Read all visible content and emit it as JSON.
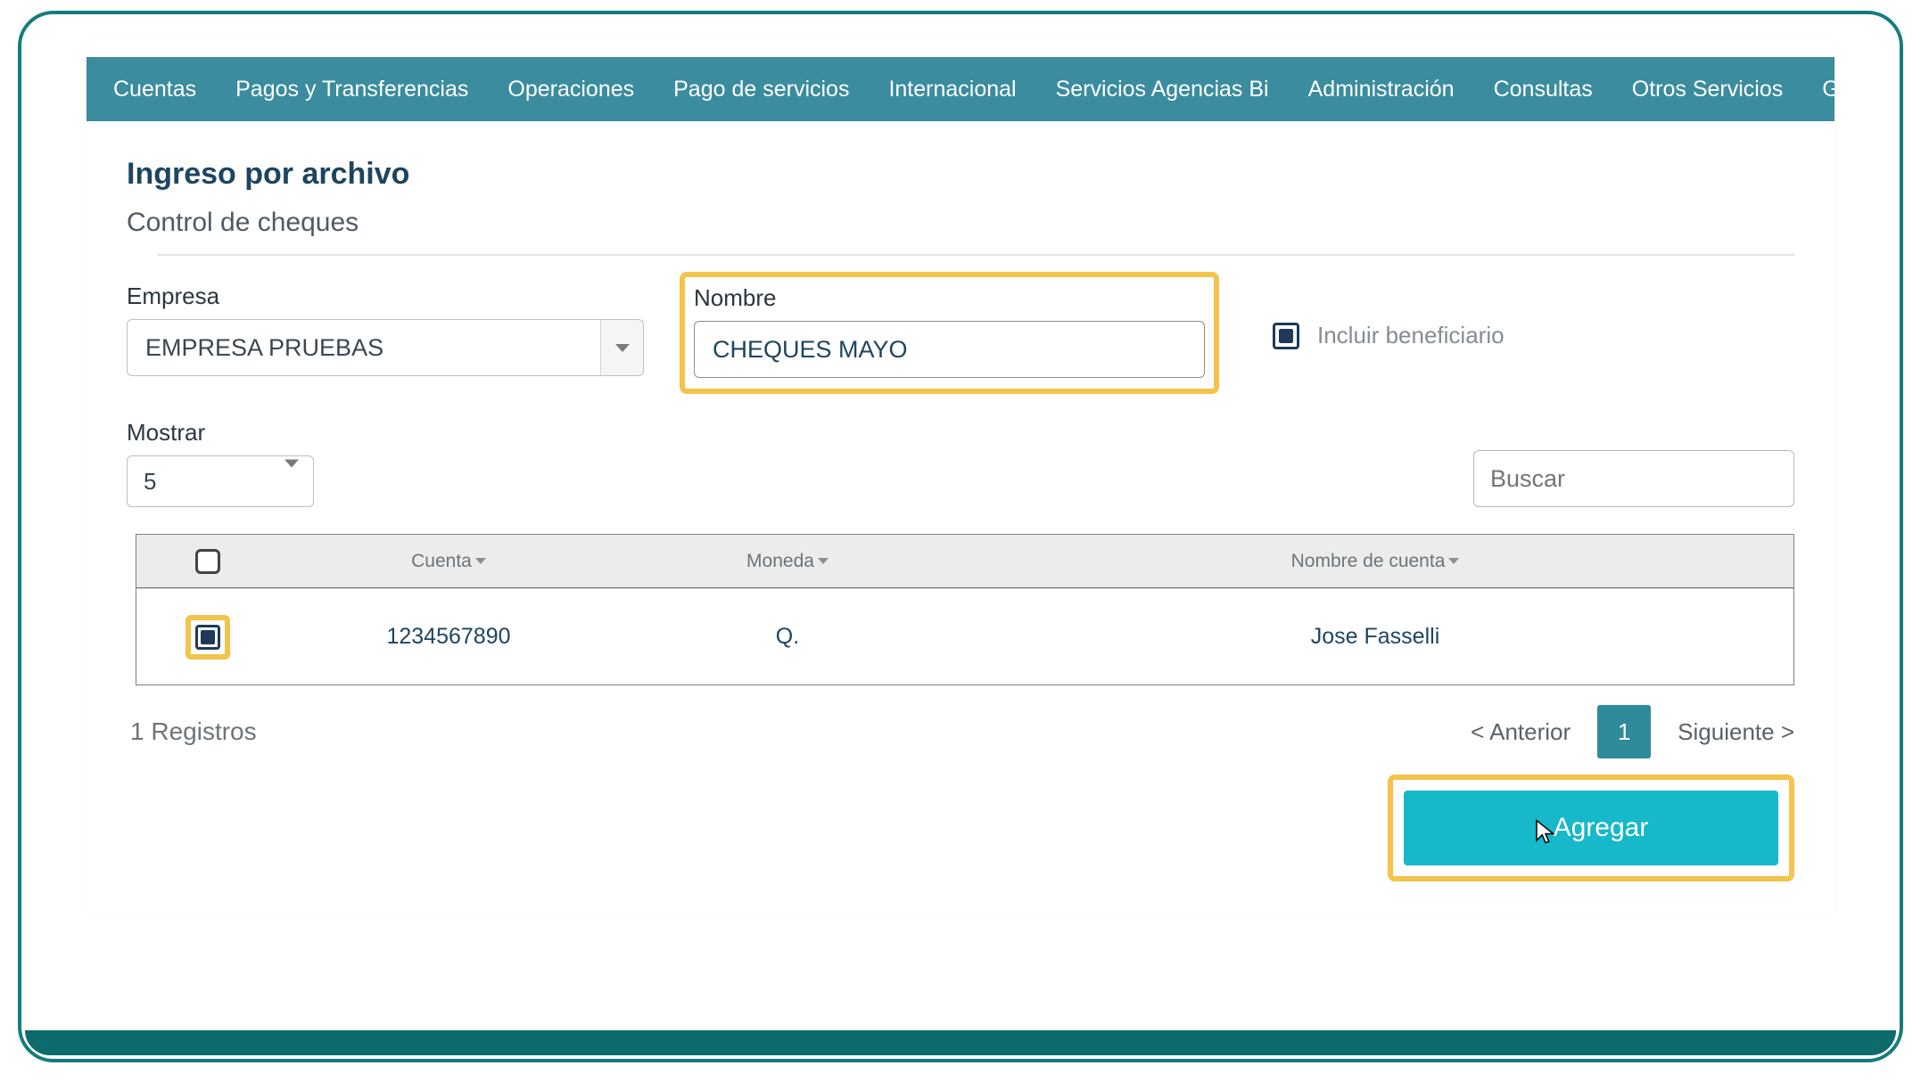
{
  "nav": {
    "items": [
      "Cuentas",
      "Pagos y Transferencias",
      "Operaciones",
      "Pago de servicios",
      "Internacional",
      "Servicios Agencias Bi",
      "Administración",
      "Consultas",
      "Otros Servicios",
      "Gestiones"
    ]
  },
  "page": {
    "title": "Ingreso por archivo",
    "subtitle": "Control de cheques"
  },
  "form": {
    "empresa_label": "Empresa",
    "empresa_value": "EMPRESA PRUEBAS",
    "nombre_label": "Nombre",
    "nombre_value": "CHEQUES MAYO",
    "incluir_label": "Incluir beneficiario",
    "incluir_checked": true,
    "mostrar_label": "Mostrar",
    "mostrar_value": "5",
    "search_placeholder": "Buscar"
  },
  "table": {
    "columns": {
      "cuenta": "Cuenta",
      "moneda": "Moneda",
      "nombre_cuenta": "Nombre de cuenta"
    },
    "rows": [
      {
        "checked": true,
        "cuenta": "1234567890",
        "moneda": "Q.",
        "nombre": "Jose Fasselli"
      }
    ]
  },
  "pagination": {
    "records_text": "1 Registros",
    "prev": "< Anterior",
    "page": "1",
    "next": "Siguiente >"
  },
  "actions": {
    "agregar": "Agregar"
  }
}
